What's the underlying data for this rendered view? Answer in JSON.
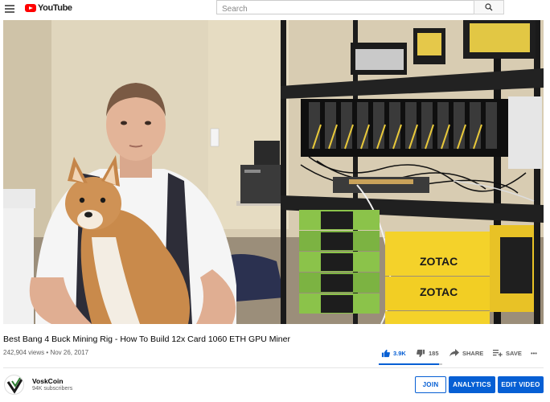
{
  "header": {
    "logo_text": "YouTube",
    "search_placeholder": "Search",
    "search_icon": "search-icon"
  },
  "video": {
    "title": "Best Bang 4 Buck Mining Rig - How To Build 12x Card 1060 ETH GPU Miner",
    "views": "242,904 views",
    "separator": "•",
    "date": "Nov 26, 2017",
    "thumbnail_labels": [
      "ZOTAC",
      "ZOTAC",
      "ZOTAC"
    ]
  },
  "actions": {
    "likes": "3.9K",
    "dislikes": "185",
    "share_label": "SHARE",
    "save_label": "SAVE",
    "more_label": "•••",
    "like_ratio": 0.95
  },
  "channel": {
    "name": "VoskCoin",
    "subscribers": "94K subscribers"
  },
  "buttons": {
    "join": "JOIN",
    "analytics": "ANALYTICS",
    "edit_video": "EDIT VIDEO"
  },
  "colors": {
    "brand_red": "#ff0000",
    "accent_blue": "#065fd4",
    "zotac_yellow": "#f4d22a",
    "green_box": "#7dc242"
  }
}
